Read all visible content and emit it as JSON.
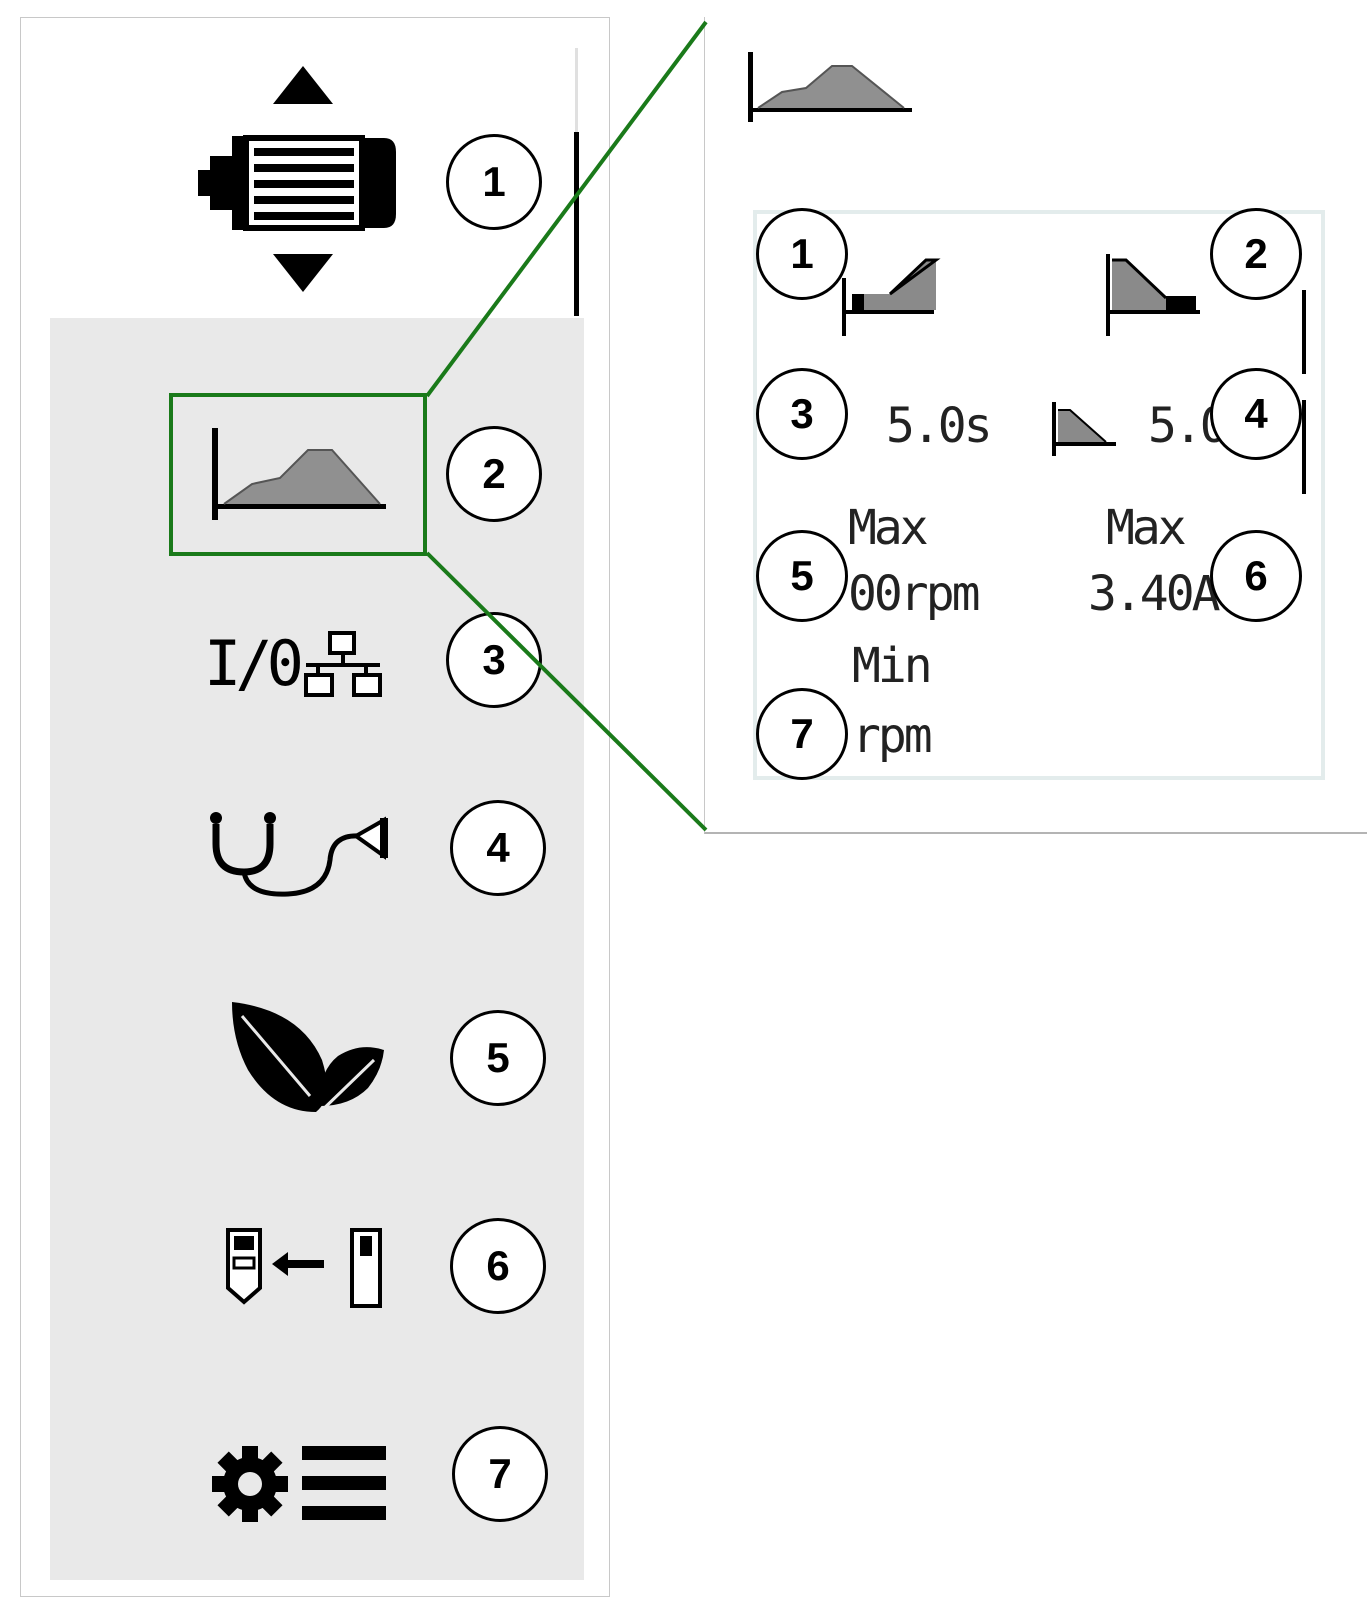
{
  "menu": {
    "items": [
      {
        "id": "motor",
        "icon": "motor-speed-icon",
        "callout": "1"
      },
      {
        "id": "ramp",
        "icon": "ramp-profile-icon",
        "callout": "2"
      },
      {
        "id": "io",
        "label": "I/0",
        "icon": "network-icon",
        "callout": "3"
      },
      {
        "id": "diagnostics",
        "icon": "stethoscope-icon",
        "callout": "4"
      },
      {
        "id": "energy",
        "icon": "leaf-icon",
        "callout": "5"
      },
      {
        "id": "copy",
        "icon": "device-copy-icon",
        "callout": "6"
      },
      {
        "id": "settings",
        "icon": "gear-menu-icon",
        "callout": "7"
      }
    ],
    "highlight_color": "#1a7a1a"
  },
  "zoom": {
    "header_icon": "ramp-profile-icon",
    "callouts": [
      "1",
      "2",
      "3",
      "4",
      "5",
      "6",
      "7"
    ],
    "accel_time": "5.0s",
    "decel_time": "5.0",
    "max_speed_label": "Max",
    "max_speed_value": "00rpm",
    "max_current_label": "Max",
    "max_current_value": "3.40A",
    "min_speed_label": "Min",
    "min_speed_value": "rpm"
  }
}
